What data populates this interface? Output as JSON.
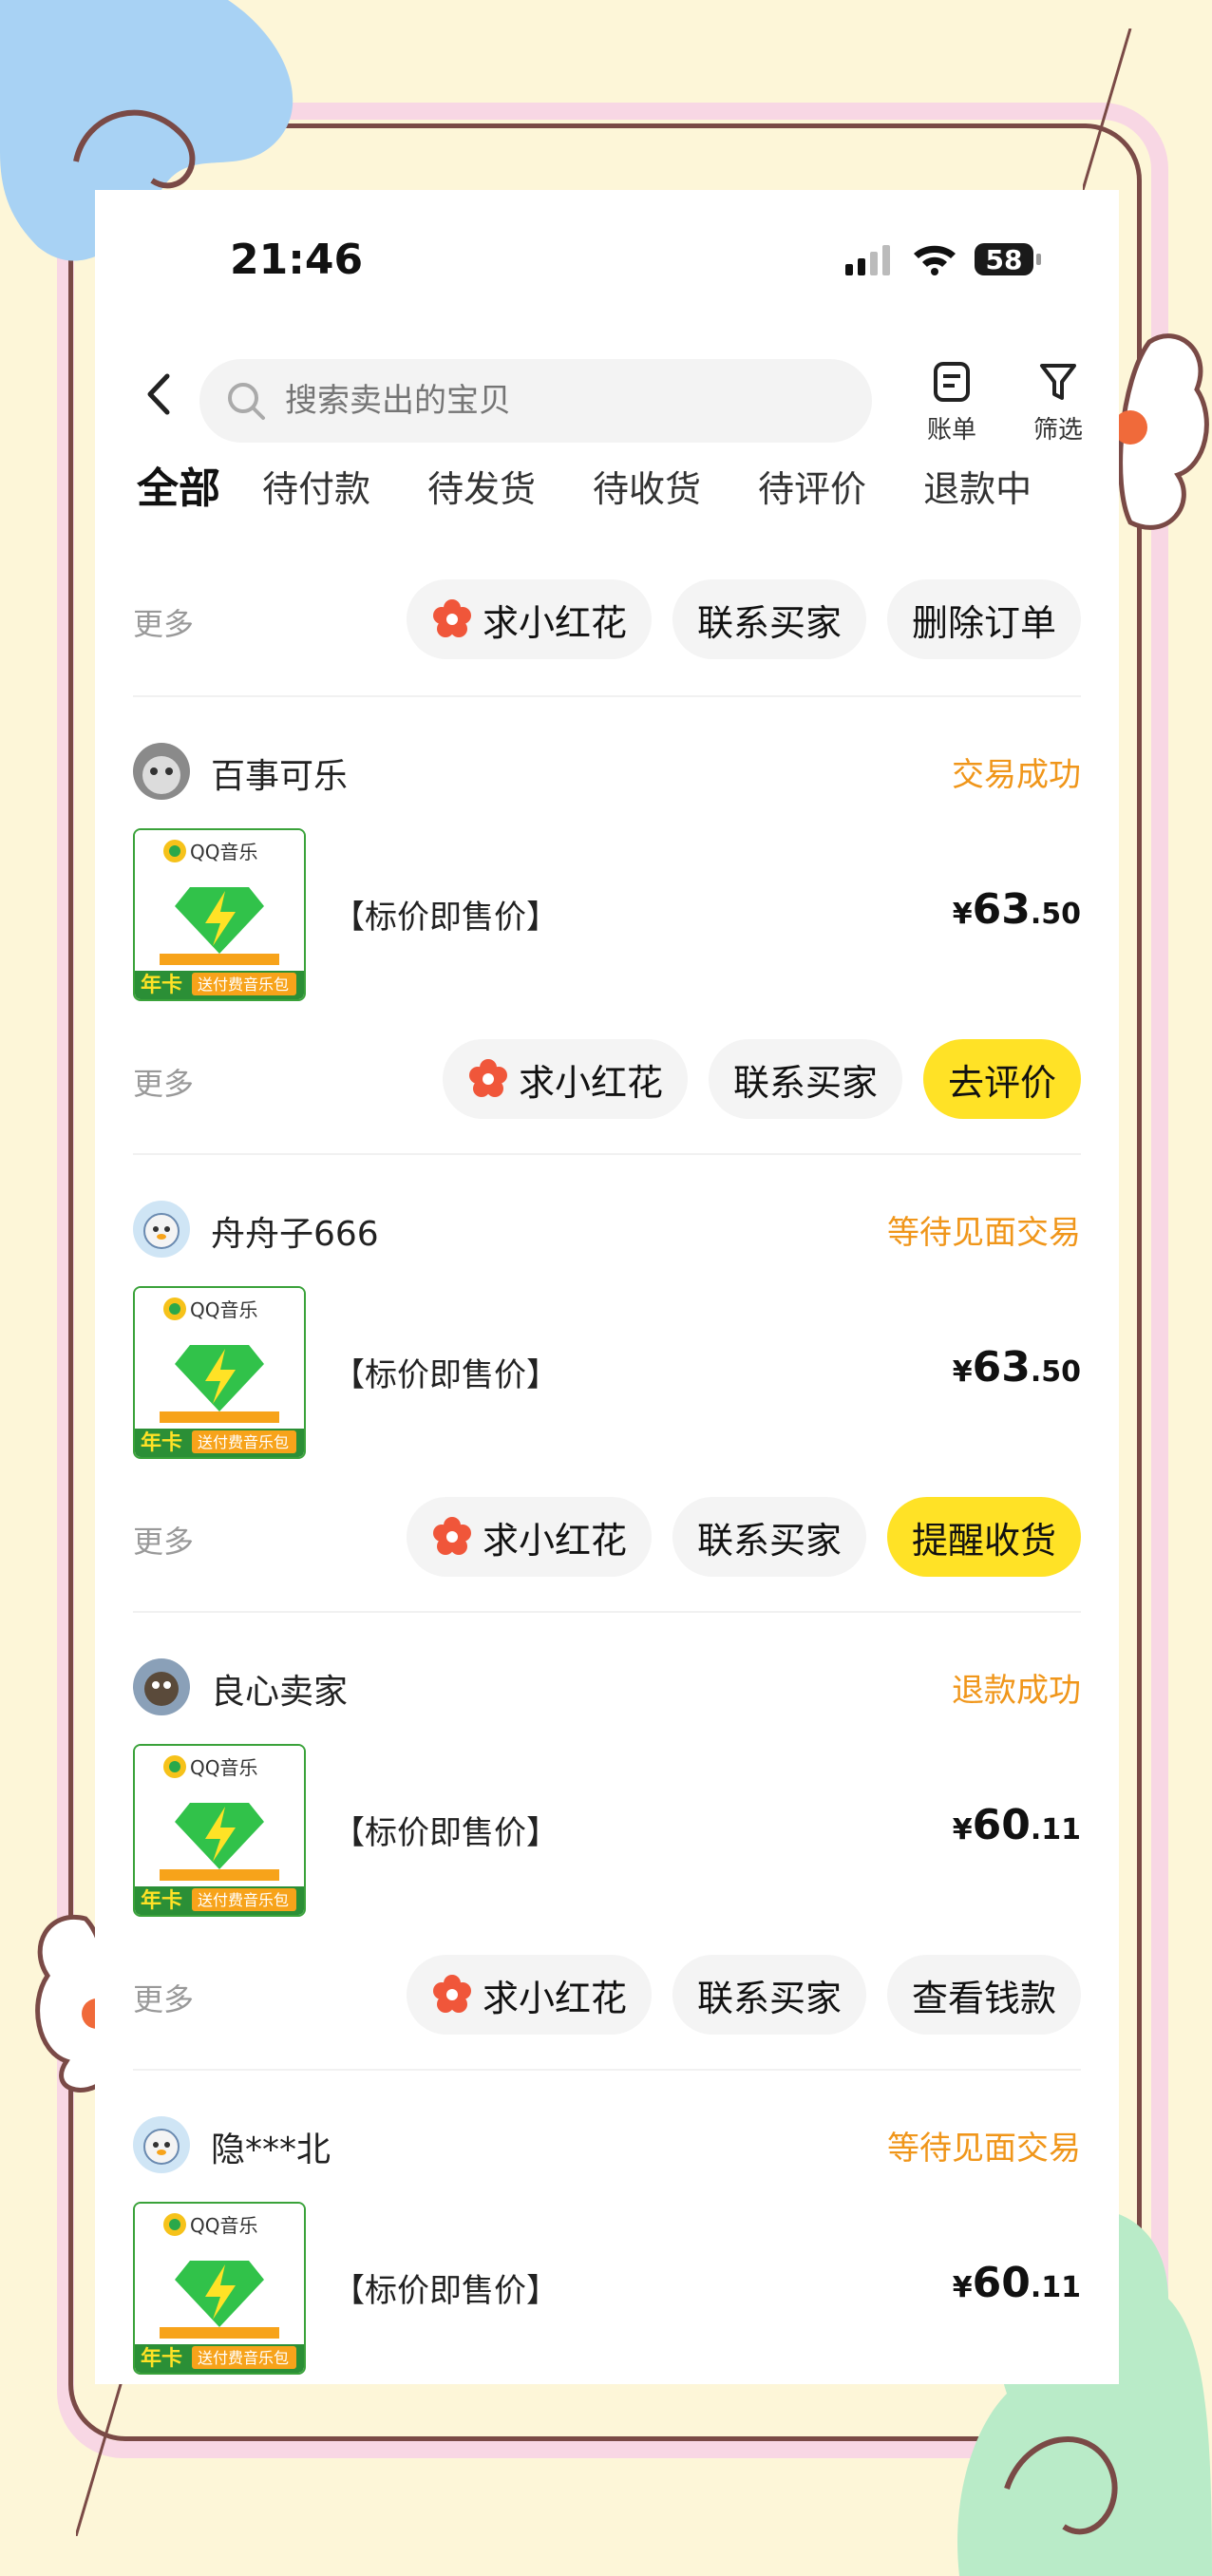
{
  "status_bar": {
    "time": "21:46",
    "battery": "58"
  },
  "search": {
    "placeholder": "搜索卖出的宝贝"
  },
  "top_actions": {
    "bill_label": "账单",
    "filter_label": "筛选"
  },
  "tabs": [
    {
      "label": "全部",
      "active": true
    },
    {
      "label": "待付款"
    },
    {
      "label": "待发货"
    },
    {
      "label": "待收货"
    },
    {
      "label": "待评价"
    },
    {
      "label": "退款中"
    }
  ],
  "top_actions_row": {
    "more": "更多",
    "flower": "求小红花",
    "contact": "联系买家",
    "delete": "删除订单"
  },
  "orders": [
    {
      "seller": "百事可乐",
      "status": "交易成功",
      "title": "【标价即售价】",
      "price_currency": "¥",
      "price_int": "63",
      "price_dec": ".50",
      "more": "更多",
      "flower": "求小红花",
      "contact": "联系买家",
      "action": "去评价",
      "product_brand": "QQ音乐",
      "badge": "年卡",
      "tag": "送付费音乐包"
    },
    {
      "seller": "舟舟子666",
      "status": "等待见面交易",
      "title": "【标价即售价】",
      "price_currency": "¥",
      "price_int": "63",
      "price_dec": ".50",
      "more": "更多",
      "flower": "求小红花",
      "contact": "联系买家",
      "action": "提醒收货",
      "product_brand": "QQ音乐",
      "badge": "年卡",
      "tag": "送付费音乐包"
    },
    {
      "seller": "良心卖家",
      "status": "退款成功",
      "title": "【标价即售价】",
      "price_currency": "¥",
      "price_int": "60",
      "price_dec": ".11",
      "more": "更多",
      "flower": "求小红花",
      "contact": "联系买家",
      "action": "查看钱款",
      "product_brand": "QQ音乐",
      "badge": "年卡",
      "tag": "送付费音乐包"
    },
    {
      "seller": "隐***北",
      "status": "等待见面交易",
      "title": "【标价即售价】",
      "price_currency": "¥",
      "price_int": "60",
      "price_dec": ".11",
      "product_brand": "QQ音乐",
      "badge": "年卡",
      "tag": "送付费音乐包"
    }
  ]
}
